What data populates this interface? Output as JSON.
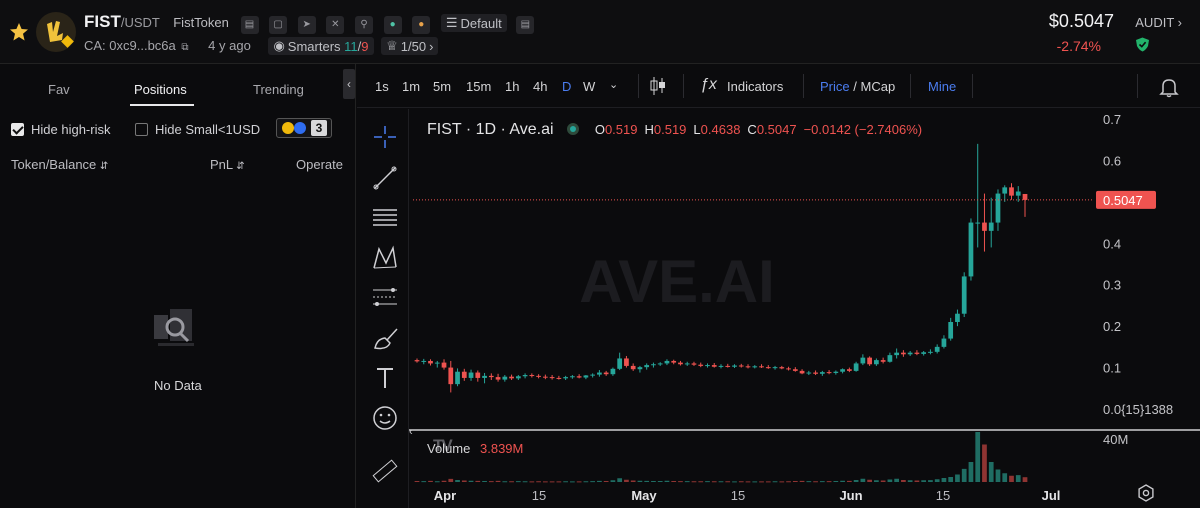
{
  "header": {
    "symbol": "FIST",
    "pair": "/USDT",
    "name": "FistToken",
    "contract": "CA: 0xc9...bc6a",
    "age": "4 y ago",
    "smarters_label": "Smarters",
    "smarters_a": "11",
    "smarters_sep": "/",
    "smarters_b": "9",
    "holders_ratio": "1/50",
    "default_label": "Default",
    "price": "$0.5047",
    "change": "-2.74%",
    "audit_label": "AUDIT"
  },
  "left_panel": {
    "tabs": [
      "Fav",
      "Positions",
      "Trending"
    ],
    "active_tab": "Positions",
    "hide_high_risk": "Hide high-risk",
    "hide_small": "Hide Small<1USD",
    "chain_count": "3",
    "col_token": "Token/Balance",
    "col_pnl": "PnL",
    "col_operate": "Operate",
    "empty_text": "No Data"
  },
  "toolbar": {
    "timeframes": [
      "1s",
      "1m",
      "5m",
      "15m",
      "1h",
      "4h",
      "D",
      "W"
    ],
    "selected": "D",
    "indicators": "Indicators",
    "price": "Price",
    "slash": "/",
    "mcap": "MCap",
    "mine": "Mine"
  },
  "legend": {
    "title": "FIST · 1D · Ave.ai",
    "o_label": "O",
    "o": "0.519",
    "h_label": "H",
    "h": "0.519",
    "l_label": "L",
    "l": "0.4638",
    "c_label": "C",
    "c": "0.5047",
    "chg": "−0.0142 (−2.7406%)",
    "volume_label": "Volume",
    "volume_value": "3.839M"
  },
  "watermark": "AVE.AI",
  "colors": {
    "up": "#26a69a",
    "down": "#ef5350",
    "accent": "#4b7df0",
    "bg": "#0b0b0d"
  },
  "chart_data": {
    "type": "candlestick",
    "title": "FIST · 1D · Ave.ai",
    "y_ticks": [
      "0.7",
      "0.6",
      "0.5",
      "0.4",
      "0.3",
      "0.2",
      "0.1",
      "0.0{15}1388"
    ],
    "ylim": [
      0.0,
      0.7
    ],
    "last_price_label": "0.5047",
    "volume_axis_label": "40M",
    "x_ticks": [
      "Apr",
      "15",
      "May",
      "15",
      "Jun",
      "15",
      "Jul"
    ],
    "candles": [
      {
        "o": 0.118,
        "h": 0.122,
        "l": 0.112,
        "c": 0.115
      },
      {
        "o": 0.115,
        "h": 0.121,
        "l": 0.108,
        "c": 0.116
      },
      {
        "o": 0.116,
        "h": 0.12,
        "l": 0.105,
        "c": 0.11
      },
      {
        "o": 0.11,
        "h": 0.116,
        "l": 0.1,
        "c": 0.112
      },
      {
        "o": 0.112,
        "h": 0.12,
        "l": 0.095,
        "c": 0.1
      },
      {
        "o": 0.1,
        "h": 0.116,
        "l": 0.04,
        "c": 0.06
      },
      {
        "o": 0.06,
        "h": 0.098,
        "l": 0.055,
        "c": 0.09
      },
      {
        "o": 0.09,
        "h": 0.097,
        "l": 0.068,
        "c": 0.075
      },
      {
        "o": 0.075,
        "h": 0.095,
        "l": 0.068,
        "c": 0.088
      },
      {
        "o": 0.088,
        "h": 0.093,
        "l": 0.066,
        "c": 0.075
      },
      {
        "o": 0.075,
        "h": 0.087,
        "l": 0.062,
        "c": 0.08
      },
      {
        "o": 0.08,
        "h": 0.086,
        "l": 0.07,
        "c": 0.077
      },
      {
        "o": 0.077,
        "h": 0.085,
        "l": 0.066,
        "c": 0.071
      },
      {
        "o": 0.071,
        "h": 0.082,
        "l": 0.066,
        "c": 0.078
      },
      {
        "o": 0.078,
        "h": 0.083,
        "l": 0.07,
        "c": 0.074
      },
      {
        "o": 0.074,
        "h": 0.082,
        "l": 0.07,
        "c": 0.079
      },
      {
        "o": 0.079,
        "h": 0.086,
        "l": 0.074,
        "c": 0.082
      },
      {
        "o": 0.082,
        "h": 0.086,
        "l": 0.076,
        "c": 0.08
      },
      {
        "o": 0.08,
        "h": 0.084,
        "l": 0.074,
        "c": 0.078
      },
      {
        "o": 0.078,
        "h": 0.083,
        "l": 0.072,
        "c": 0.077
      },
      {
        "o": 0.077,
        "h": 0.082,
        "l": 0.071,
        "c": 0.075
      },
      {
        "o": 0.075,
        "h": 0.08,
        "l": 0.071,
        "c": 0.074
      },
      {
        "o": 0.074,
        "h": 0.08,
        "l": 0.07,
        "c": 0.077
      },
      {
        "o": 0.077,
        "h": 0.082,
        "l": 0.073,
        "c": 0.079
      },
      {
        "o": 0.079,
        "h": 0.084,
        "l": 0.074,
        "c": 0.076
      },
      {
        "o": 0.076,
        "h": 0.082,
        "l": 0.072,
        "c": 0.081
      },
      {
        "o": 0.081,
        "h": 0.086,
        "l": 0.076,
        "c": 0.083
      },
      {
        "o": 0.083,
        "h": 0.094,
        "l": 0.078,
        "c": 0.088
      },
      {
        "o": 0.088,
        "h": 0.092,
        "l": 0.08,
        "c": 0.084
      },
      {
        "o": 0.084,
        "h": 0.1,
        "l": 0.08,
        "c": 0.097
      },
      {
        "o": 0.097,
        "h": 0.136,
        "l": 0.094,
        "c": 0.122
      },
      {
        "o": 0.122,
        "h": 0.128,
        "l": 0.1,
        "c": 0.104
      },
      {
        "o": 0.104,
        "h": 0.11,
        "l": 0.092,
        "c": 0.096
      },
      {
        "o": 0.096,
        "h": 0.104,
        "l": 0.088,
        "c": 0.101
      },
      {
        "o": 0.101,
        "h": 0.11,
        "l": 0.095,
        "c": 0.106
      },
      {
        "o": 0.106,
        "h": 0.112,
        "l": 0.1,
        "c": 0.108
      },
      {
        "o": 0.108,
        "h": 0.113,
        "l": 0.104,
        "c": 0.11
      },
      {
        "o": 0.11,
        "h": 0.12,
        "l": 0.106,
        "c": 0.116
      },
      {
        "o": 0.116,
        "h": 0.119,
        "l": 0.108,
        "c": 0.112
      },
      {
        "o": 0.112,
        "h": 0.116,
        "l": 0.105,
        "c": 0.108
      },
      {
        "o": 0.108,
        "h": 0.114,
        "l": 0.104,
        "c": 0.11
      },
      {
        "o": 0.11,
        "h": 0.114,
        "l": 0.104,
        "c": 0.107
      },
      {
        "o": 0.107,
        "h": 0.112,
        "l": 0.101,
        "c": 0.104
      },
      {
        "o": 0.104,
        "h": 0.11,
        "l": 0.1,
        "c": 0.106
      },
      {
        "o": 0.106,
        "h": 0.111,
        "l": 0.1,
        "c": 0.102
      },
      {
        "o": 0.102,
        "h": 0.108,
        "l": 0.098,
        "c": 0.104
      },
      {
        "o": 0.104,
        "h": 0.109,
        "l": 0.1,
        "c": 0.102
      },
      {
        "o": 0.102,
        "h": 0.108,
        "l": 0.099,
        "c": 0.105
      },
      {
        "o": 0.105,
        "h": 0.109,
        "l": 0.1,
        "c": 0.103
      },
      {
        "o": 0.103,
        "h": 0.108,
        "l": 0.098,
        "c": 0.101
      },
      {
        "o": 0.101,
        "h": 0.106,
        "l": 0.098,
        "c": 0.103
      },
      {
        "o": 0.103,
        "h": 0.108,
        "l": 0.099,
        "c": 0.101
      },
      {
        "o": 0.101,
        "h": 0.106,
        "l": 0.097,
        "c": 0.099
      },
      {
        "o": 0.099,
        "h": 0.104,
        "l": 0.095,
        "c": 0.101
      },
      {
        "o": 0.101,
        "h": 0.104,
        "l": 0.096,
        "c": 0.098
      },
      {
        "o": 0.098,
        "h": 0.102,
        "l": 0.093,
        "c": 0.096
      },
      {
        "o": 0.096,
        "h": 0.101,
        "l": 0.09,
        "c": 0.092
      },
      {
        "o": 0.092,
        "h": 0.096,
        "l": 0.084,
        "c": 0.086
      },
      {
        "o": 0.086,
        "h": 0.092,
        "l": 0.082,
        "c": 0.088
      },
      {
        "o": 0.088,
        "h": 0.093,
        "l": 0.082,
        "c": 0.085
      },
      {
        "o": 0.085,
        "h": 0.092,
        "l": 0.08,
        "c": 0.089
      },
      {
        "o": 0.089,
        "h": 0.094,
        "l": 0.084,
        "c": 0.087
      },
      {
        "o": 0.087,
        "h": 0.093,
        "l": 0.083,
        "c": 0.09
      },
      {
        "o": 0.09,
        "h": 0.098,
        "l": 0.086,
        "c": 0.096
      },
      {
        "o": 0.096,
        "h": 0.1,
        "l": 0.089,
        "c": 0.092
      },
      {
        "o": 0.092,
        "h": 0.114,
        "l": 0.09,
        "c": 0.11
      },
      {
        "o": 0.11,
        "h": 0.132,
        "l": 0.106,
        "c": 0.124
      },
      {
        "o": 0.124,
        "h": 0.127,
        "l": 0.104,
        "c": 0.108
      },
      {
        "o": 0.108,
        "h": 0.122,
        "l": 0.104,
        "c": 0.118
      },
      {
        "o": 0.118,
        "h": 0.124,
        "l": 0.11,
        "c": 0.114
      },
      {
        "o": 0.114,
        "h": 0.136,
        "l": 0.112,
        "c": 0.13
      },
      {
        "o": 0.13,
        "h": 0.146,
        "l": 0.122,
        "c": 0.136
      },
      {
        "o": 0.136,
        "h": 0.142,
        "l": 0.126,
        "c": 0.132
      },
      {
        "o": 0.132,
        "h": 0.14,
        "l": 0.128,
        "c": 0.136
      },
      {
        "o": 0.136,
        "h": 0.142,
        "l": 0.13,
        "c": 0.133
      },
      {
        "o": 0.133,
        "h": 0.14,
        "l": 0.129,
        "c": 0.137
      },
      {
        "o": 0.137,
        "h": 0.144,
        "l": 0.132,
        "c": 0.138
      },
      {
        "o": 0.138,
        "h": 0.156,
        "l": 0.134,
        "c": 0.15
      },
      {
        "o": 0.15,
        "h": 0.178,
        "l": 0.146,
        "c": 0.17
      },
      {
        "o": 0.17,
        "h": 0.22,
        "l": 0.165,
        "c": 0.21
      },
      {
        "o": 0.21,
        "h": 0.24,
        "l": 0.2,
        "c": 0.23
      },
      {
        "o": 0.23,
        "h": 0.33,
        "l": 0.222,
        "c": 0.32
      },
      {
        "o": 0.32,
        "h": 0.46,
        "l": 0.31,
        "c": 0.45
      },
      {
        "o": 0.45,
        "h": 0.64,
        "l": 0.39,
        "c": 0.45
      },
      {
        "o": 0.45,
        "h": 0.52,
        "l": 0.38,
        "c": 0.43
      },
      {
        "o": 0.43,
        "h": 0.51,
        "l": 0.39,
        "c": 0.45
      },
      {
        "o": 0.45,
        "h": 0.53,
        "l": 0.43,
        "c": 0.52
      },
      {
        "o": 0.52,
        "h": 0.54,
        "l": 0.5,
        "c": 0.535
      },
      {
        "o": 0.535,
        "h": 0.545,
        "l": 0.505,
        "c": 0.515
      },
      {
        "o": 0.515,
        "h": 0.538,
        "l": 0.5,
        "c": 0.525
      },
      {
        "o": 0.519,
        "h": 0.519,
        "l": 0.4638,
        "c": 0.5047
      }
    ],
    "volume_max": 40,
    "volume_millions": [
      0.8,
      0.7,
      0.9,
      0.6,
      1.0,
      2.5,
      1.6,
      1.2,
      1.0,
      0.9,
      0.8,
      0.7,
      0.9,
      0.6,
      0.6,
      0.7,
      0.6,
      0.5,
      0.6,
      0.5,
      0.5,
      0.5,
      0.6,
      0.5,
      0.5,
      0.6,
      0.7,
      0.9,
      0.8,
      1.4,
      3.0,
      1.8,
      1.2,
      1.0,
      0.9,
      0.8,
      0.8,
      1.0,
      0.8,
      0.7,
      0.7,
      0.6,
      0.6,
      0.7,
      0.6,
      0.6,
      0.6,
      0.5,
      0.6,
      0.5,
      0.5,
      0.5,
      0.5,
      0.6,
      0.5,
      0.6,
      0.8,
      0.9,
      0.7,
      0.6,
      0.7,
      0.7,
      0.8,
      1.0,
      0.9,
      1.6,
      2.6,
      1.8,
      1.4,
      1.2,
      2.0,
      2.6,
      1.6,
      1.4,
      1.2,
      1.4,
      1.5,
      2.2,
      3.2,
      4.0,
      6.0,
      10.5,
      16.0,
      40.0,
      30.0,
      16.0,
      10.0,
      7.0,
      5.0,
      5.5,
      3.839
    ]
  }
}
